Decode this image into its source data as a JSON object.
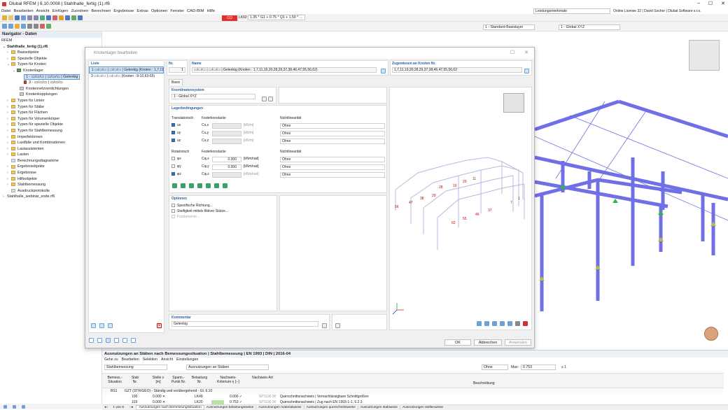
{
  "app": {
    "title": "Dlubal RFEM | 6.10.0008 | Stahlhalle_fertig (1).rf6",
    "search_hint": "Leistungsmerkmale",
    "license": "Online License 32 | David Sochor | Dlubal Software s.r.o."
  },
  "menu": [
    "Datei",
    "Bearbeiten",
    "Ansicht",
    "Einfügen",
    "Zuordnen",
    "Berechnen",
    "Ergebnisse",
    "Extras",
    "Optionen",
    "Fenster",
    "CAD-BIM",
    "Hilfe"
  ],
  "toolbar": {
    "lk_label": "LK60",
    "combo_formula": "1.35 * G1 + 0.75 * Q1 + 1.50 * ...",
    "basislayer": "1 - Standard-Basislayer",
    "coord_system": "1 - Global XYZ"
  },
  "navigator": {
    "title": "Navigator - Daten",
    "root": "RFEM",
    "project": "Stahlhalle_fertig (1).rf6",
    "items": [
      "Basisobjekte",
      "Spezielle Objekte",
      "Typen für Knoten",
      "Knotenlager",
      "1 - ▭/▭/▭ | ▭/▭/▭ | Gelenkig",
      "3 - ▭/▭/▭ | ▭/▭/▭",
      "Knotennetzverdichtungen",
      "Knotenkopplungen",
      "Typen für Linien",
      "Typen für Stäbe",
      "Typen für Flächen",
      "Typen für Volumenkörper",
      "Typen für spezielle Objekte",
      "Typen für Stahlbemessung",
      "Imperfektionen",
      "Lastfälle und Kombinationen",
      "Lastassistenten",
      "Lasten",
      "Berechnungsdiagramme",
      "Ergebnisobjekte",
      "Ergebnisse",
      "Hilfsobjekte",
      "Stahlbemessung",
      "Ausdruckprotokolle"
    ],
    "second_project": "Stahlhalle_webinar_ende.rf6"
  },
  "dialog": {
    "title": "Knotenlager bearbeiten",
    "list_header": "Liste",
    "list": [
      "1 ▭/▭/▭ | ▭/▭/▭ | Gelenkig (Knoten : 1,7,11,",
      "3 ▭/▭/▭ | ▭/▭/▭ (Knoten : 8-10,63-65)"
    ],
    "nr_label": "Nr.",
    "nr_value": "1",
    "name_label": "Name",
    "name_value": "▭/▭/▭ | ▭/▭/▭ | Gelenkig (Knoten : 1,7,11,19,20,28,29,37,38,46,47,55,56,62)",
    "assigned_label": "Zugewiesen an Knoten Nr.",
    "assigned_value": "1,7,11,19,20,28,29,37,38,46,47,55,56,62",
    "tab": "Basis",
    "coord_label": "Koordinatensystem",
    "coord_value": "1 - Global XYZ",
    "bc_label": "Lagerbedingungen",
    "trans_label": "Translatorisch",
    "spring_label": "Federkonstante",
    "nonlin_label": "Nichtlinearität",
    "trans": [
      {
        "name": "ux",
        "c": "Cu,x",
        "unit": "[kN/m]",
        "nl": "Ohne",
        "on": true
      },
      {
        "name": "uy",
        "c": "Cu,y",
        "unit": "[kN/m]",
        "nl": "Ohne",
        "on": true
      },
      {
        "name": "uz",
        "c": "Cu,z",
        "unit": "[kN/m]",
        "nl": "Ohne",
        "on": true
      }
    ],
    "rot_label": "Rotatorisch",
    "rot": [
      {
        "name": "φx",
        "c": "Cφ,x",
        "val": "0.000",
        "unit": "[kNm/rad]",
        "nl": "Ohne",
        "on": false
      },
      {
        "name": "φy",
        "c": "Cφ,y",
        "val": "0.000",
        "unit": "[kNm/rad]",
        "nl": "Ohne",
        "on": false
      },
      {
        "name": "φz",
        "c": "Cφ,z",
        "val": "",
        "unit": "[kNm/rad]",
        "nl": "Ohne",
        "on": true
      }
    ],
    "options_label": "Optionen",
    "opt1": "Spezifische Richtung...",
    "opt2": "Steifigkeit mittels fiktiver Stütze...",
    "opt3": "Fundamente...",
    "comment_label": "Kommentar",
    "comment_value": "Gelenkig",
    "ok": "OK",
    "cancel": "Abbrechen",
    "apply": "Anwenden"
  },
  "results": {
    "title": "Ausnutzungen an Stäben nach Bemessungssituation | Stahlbemessung | EN 1993 | DIN | 2016-04",
    "menu": [
      "Gehe zu",
      "Bearbeiten",
      "Selektion",
      "Ansicht",
      "Einstellungen"
    ],
    "combo1": "Stahlbemessung",
    "combo2": "Ausnutzungen an Stäben",
    "filter": "Ohne",
    "max_label": "Max:",
    "max_value": "0.753",
    "ratio": "≤ 1",
    "headers": [
      "Bemess.-Situation",
      "Stab Nr.",
      "Stelle x [m]",
      "Spann.-Punkt Nr.",
      "Belastung Nr.",
      "Nachweis-Kriterium η [--]",
      "Nachweis-Art",
      "Beschreibung"
    ],
    "rows": [
      {
        "sit": "BS1",
        "desc": "GZT (STR/GEO) - Ständig und vorübergehend - Gl. 6.10"
      },
      {
        "stab": "100",
        "x": "0.000 ✕",
        "last": "LK49",
        "eta": "0.000 ✓",
        "art": "SP1100.00",
        "desc": "Querschnittsnachweis | Vernachlässigbare Schnittgrößen"
      },
      {
        "stab": "103",
        "x": "0.000 ✕",
        "last": "LK20",
        "eta": "0.753 ✓",
        "art": "SP1100.00",
        "desc": "Querschnittsnachweis | Zug nach EN 1993-1-1, 6.2.3"
      }
    ],
    "page": "1 von 6",
    "tabs": [
      "Ausnutzungen nach Bemessungssituation",
      "Ausnutzungen belastungsweise",
      "Ausnutzungen materialweise",
      "Ausnutzungen querschnittsweise",
      "Ausnutzungen stabweise",
      "Ausnutzungen stellenweise"
    ]
  },
  "labels3d": [
    "56",
    "47",
    "38",
    "29",
    "28",
    "19",
    "20",
    "11",
    "1",
    "7",
    "62",
    "55",
    "46",
    "37"
  ]
}
